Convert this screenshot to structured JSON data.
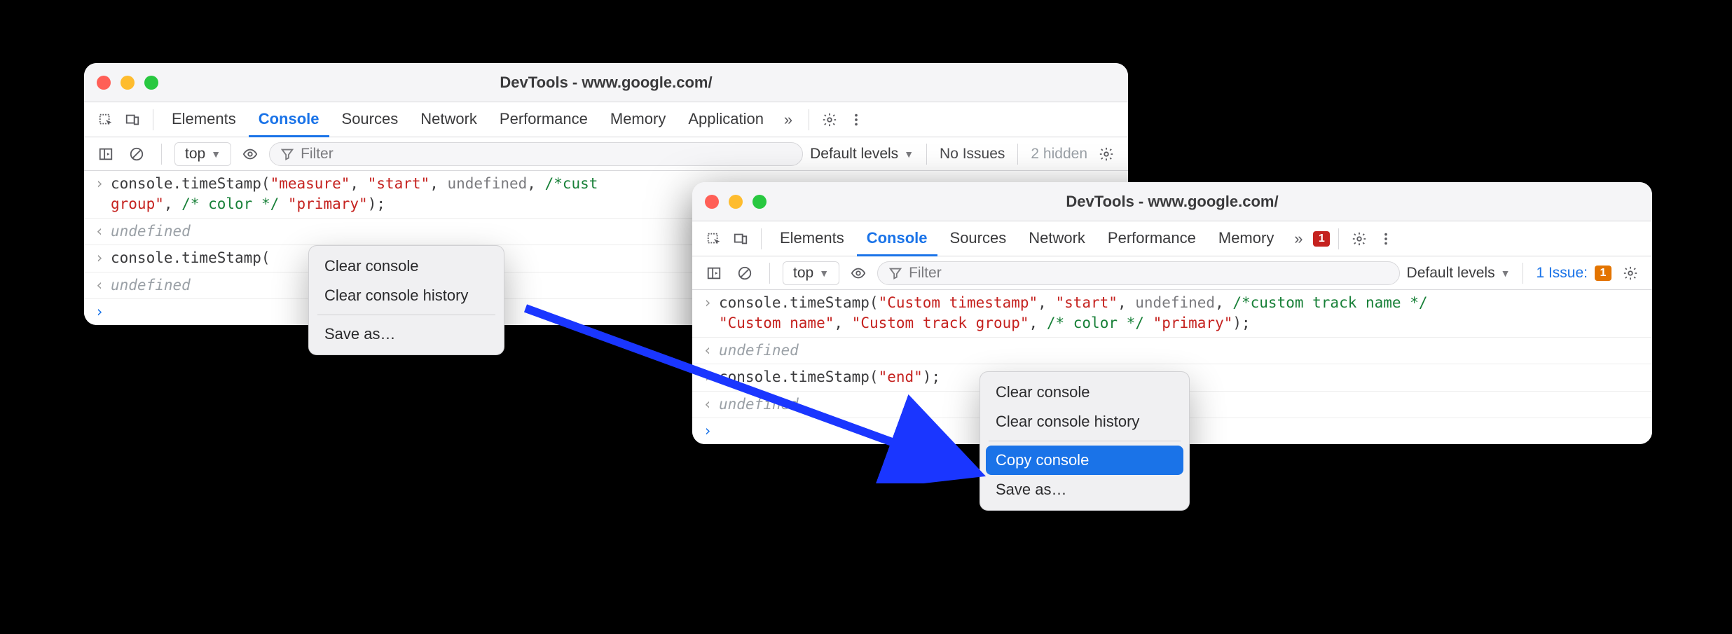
{
  "window_left": {
    "title": "DevTools - www.google.com/",
    "tabs": [
      "Elements",
      "Console",
      "Sources",
      "Network",
      "Performance",
      "Memory",
      "Application"
    ],
    "active_tab": "Console",
    "filterbar": {
      "context": "top",
      "filter_placeholder": "Filter",
      "levels": "Default levels",
      "issues": "No Issues",
      "hidden": "2 hidden"
    },
    "console": {
      "line1": {
        "fn_prefix": "console.timeStamp(",
        "a1": "\"measure\"",
        "a2": "\"start\"",
        "a3": "undefined",
        "cmt1_partial": "/*cust",
        "l2_str": "group\"",
        "cmt2": "/* color */",
        "a5": "\"primary\"",
        "suffix": ");"
      },
      "ret1": "undefined",
      "line2": {
        "prefix": "console.timeStamp("
      },
      "ret2": "undefined"
    },
    "menu": {
      "clear": "Clear console",
      "history": "Clear console history",
      "save": "Save as…"
    }
  },
  "window_right": {
    "title": "DevTools - www.google.com/",
    "tabs": [
      "Elements",
      "Console",
      "Sources",
      "Network",
      "Performance",
      "Memory"
    ],
    "active_tab": "Console",
    "error_badge": "1",
    "filterbar": {
      "context": "top",
      "filter_placeholder": "Filter",
      "levels": "Default levels",
      "issues": "1 Issue:",
      "issue_badge": "1"
    },
    "console": {
      "line1": {
        "fn_prefix": "console.timeStamp(",
        "a1": "\"Custom timestamp\"",
        "a2": "\"start\"",
        "a3": "undefined",
        "cmt1": "/*custom track name */",
        "l2_s1": "\"Custom name\"",
        "l2_s2": "\"Custom track group\"",
        "cmt2": "/* color */",
        "a5": "\"primary\"",
        "suffix": ");"
      },
      "ret1": "undefined",
      "line2": {
        "prefix": "console.timeStamp(",
        "arg": "\"end\"",
        "suffix": ");"
      },
      "ret2": "undefined"
    },
    "menu": {
      "clear": "Clear console",
      "history": "Clear console history",
      "copy": "Copy console",
      "save": "Save as…"
    }
  }
}
